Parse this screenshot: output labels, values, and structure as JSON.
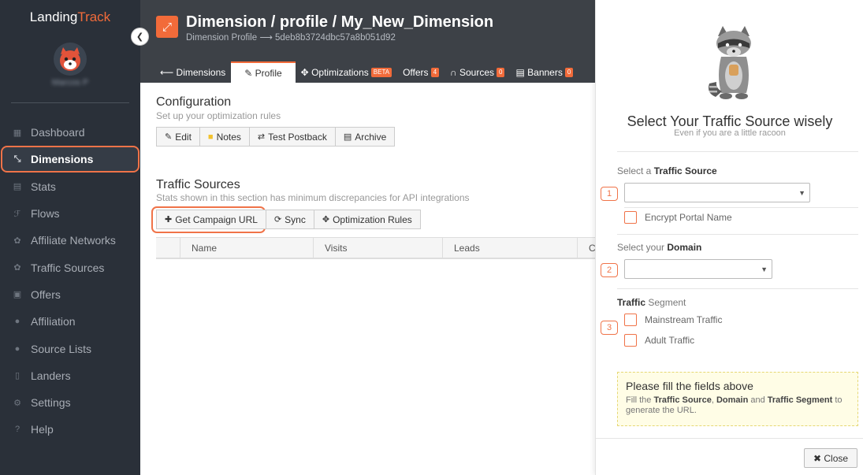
{
  "app": {
    "logo_main": "Landing",
    "logo_accent": "Track",
    "user_name": "Marcos P"
  },
  "sidebar": {
    "items": [
      {
        "label": "Dashboard",
        "icon": "dashboard-icon"
      },
      {
        "label": "Dimensions",
        "icon": "expand-arrows-icon",
        "active": true
      },
      {
        "label": "Stats",
        "icon": "bar-chart-icon"
      },
      {
        "label": "Flows",
        "icon": "flow-icon"
      },
      {
        "label": "Affiliate Networks",
        "icon": "plug-icon"
      },
      {
        "label": "Traffic Sources",
        "icon": "plug-icon"
      },
      {
        "label": "Offers",
        "icon": "image-icon"
      },
      {
        "label": "Affiliation",
        "icon": "users-icon"
      },
      {
        "label": "Source Lists",
        "icon": "users-icon"
      },
      {
        "label": "Landers",
        "icon": "file-icon"
      },
      {
        "label": "Settings",
        "icon": "gear-icon"
      },
      {
        "label": "Help",
        "icon": "question-icon"
      }
    ]
  },
  "header": {
    "title": "Dimension / profile / My_New_Dimension",
    "subtitle": "Dimension Profile ⟶ 5deb8b3724dbc57a8b051d92",
    "tabs": [
      {
        "label": "Dimensions"
      },
      {
        "label": "Profile"
      },
      {
        "label": "Optimizations",
        "badge": "BETA"
      },
      {
        "label": "Offers",
        "badge": "4"
      },
      {
        "label": "Sources",
        "badge": "0"
      },
      {
        "label": "Banners",
        "badge": "0"
      }
    ]
  },
  "configuration": {
    "title": "Configuration",
    "subtitle": "Set up your optimization rules",
    "buttons": [
      "Edit",
      "Notes",
      "Test Postback",
      "Archive"
    ]
  },
  "traffic_sources": {
    "title": "Traffic Sources",
    "subtitle": "Stats shown in this section has minimum discrepancies for API integrations",
    "buttons": [
      "Get Campaign URL",
      "Sync",
      "Optimization Rules"
    ],
    "columns": [
      "Name",
      "Visits",
      "Leads",
      "C"
    ]
  },
  "panel": {
    "title": "Select Your Traffic Source wisely",
    "subtitle": "Even if you are a little racoon",
    "source_label_prefix": "Select a ",
    "source_label_bold": "Traffic Source",
    "encrypt_label": "Encrypt Portal Name",
    "domain_label_prefix": "Select your ",
    "domain_label_bold": "Domain",
    "segment_label_bold": "Traffic",
    "segment_label_suffix": " Segment",
    "segments": [
      "Mainstream Traffic",
      "Adult Traffic"
    ],
    "steps": [
      "1",
      "2",
      "3"
    ],
    "notice_title": "Please fill the fields above",
    "notice_pre": "Fill the ",
    "notice_b1": "Traffic Source",
    "notice_sep1": ", ",
    "notice_b2": "Domain",
    "notice_sep2": " and ",
    "notice_b3": "Traffic Segment",
    "notice_post": " to generate the URL.",
    "close_label": "Close"
  },
  "colors": {
    "accent": "#f26b3a",
    "sidebar": "#2a3039",
    "topbar": "#3d4147"
  }
}
